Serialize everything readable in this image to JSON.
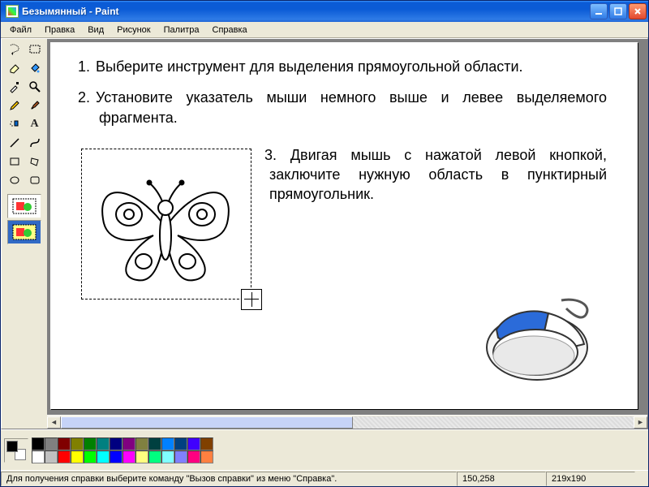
{
  "title": "Безымянный - Paint",
  "menu": [
    "Файл",
    "Правка",
    "Вид",
    "Рисунок",
    "Палитра",
    "Справка"
  ],
  "tool_names": [
    "freeform-select",
    "rect-select",
    "eraser",
    "fill",
    "eyedropper",
    "magnifier",
    "pencil",
    "brush",
    "airbrush",
    "text",
    "line",
    "curve",
    "rectangle",
    "polygon",
    "ellipse",
    "rounded-rect"
  ],
  "instructions": {
    "step1_num": "1.",
    "step1": "Выберите инструмент для выделения прямоугольной области.",
    "step2_num": "2.",
    "step2": "Установите указатель мыши немного выше и левее выделяемого фрагмента.",
    "step3_num": "3.",
    "step3": "Двигая мышь с нажатой левой кнопкой, заключите нужную область в пунктирный прямоугольник."
  },
  "palette_row1": [
    "#000000",
    "#808080",
    "#800000",
    "#808000",
    "#008000",
    "#008080",
    "#000080",
    "#800080",
    "#808040",
    "#004040",
    "#0080ff",
    "#004080",
    "#4000ff",
    "#804000"
  ],
  "palette_row2": [
    "#ffffff",
    "#c0c0c0",
    "#ff0000",
    "#ffff00",
    "#00ff00",
    "#00ffff",
    "#0000ff",
    "#ff00ff",
    "#ffff80",
    "#00ff80",
    "#80ffff",
    "#8080ff",
    "#ff0080",
    "#ff8040"
  ],
  "status": {
    "help": "Для получения справки выберите команду \"Вызов справки\" из меню \"Справка\".",
    "pos": "150,258",
    "size": "219x190"
  }
}
